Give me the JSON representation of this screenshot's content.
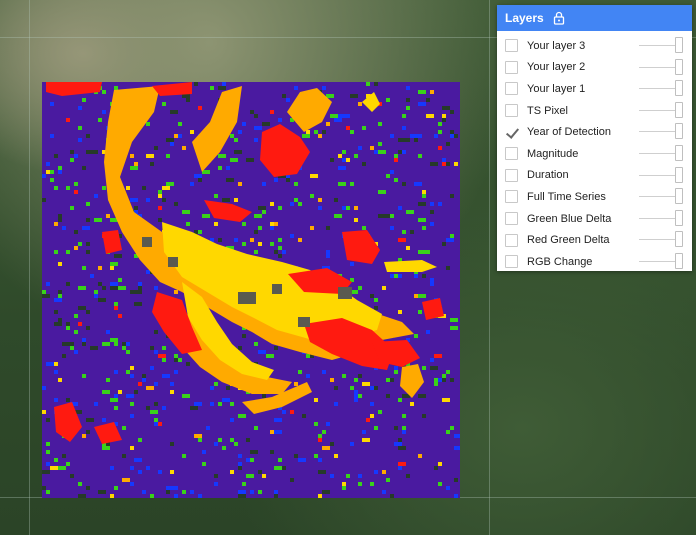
{
  "map": {
    "overlay_colors": {
      "background": "#4a1aa0",
      "orange": "#ffaa00",
      "yellow": "#ffd800",
      "red": "#ff1a10",
      "green": "#39d21a",
      "blue": "#1538ff",
      "dark": "#263a2a"
    }
  },
  "layers_panel": {
    "title": "Layers",
    "lock_icon": "lock-icon",
    "accent_color": "#4285f4",
    "layers": [
      {
        "label": "Your layer 3",
        "checked": false
      },
      {
        "label": "Your layer 2",
        "checked": false
      },
      {
        "label": "Your layer 1",
        "checked": false
      },
      {
        "label": "TS Pixel",
        "checked": false
      },
      {
        "label": "Year of Detection",
        "checked": true
      },
      {
        "label": "Magnitude",
        "checked": false
      },
      {
        "label": "Duration",
        "checked": false
      },
      {
        "label": "Full Time Series",
        "checked": false
      },
      {
        "label": "Green Blue Delta",
        "checked": false
      },
      {
        "label": "Red Green Delta",
        "checked": false
      },
      {
        "label": "RGB Change",
        "checked": false
      }
    ]
  }
}
